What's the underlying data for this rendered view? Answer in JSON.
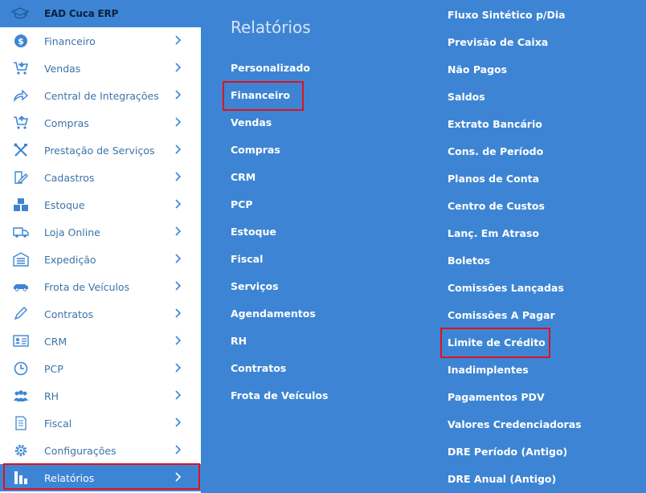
{
  "app": {
    "title": "EAD Cuca ERP"
  },
  "sidebar": {
    "items": [
      {
        "label": "Financeiro",
        "icon": "dollar-icon"
      },
      {
        "label": "Vendas",
        "icon": "cart-icon"
      },
      {
        "label": "Central de Integrações",
        "icon": "share-icon"
      },
      {
        "label": "Compras",
        "icon": "cart-icon"
      },
      {
        "label": "Prestação de Serviços",
        "icon": "tools-icon"
      },
      {
        "label": "Cadastros",
        "icon": "edit-icon"
      },
      {
        "label": "Estoque",
        "icon": "boxes-icon"
      },
      {
        "label": "Loja Online",
        "icon": "truck-icon"
      },
      {
        "label": "Expedição",
        "icon": "warehouse-icon"
      },
      {
        "label": "Frota de Veículos",
        "icon": "car-icon"
      },
      {
        "label": "Contratos",
        "icon": "pen-icon"
      },
      {
        "label": "CRM",
        "icon": "id-card-icon"
      },
      {
        "label": "PCP",
        "icon": "clock-icon"
      },
      {
        "label": "RH",
        "icon": "users-icon"
      },
      {
        "label": "Fiscal",
        "icon": "document-icon"
      },
      {
        "label": "Configurações",
        "icon": "gear-icon"
      },
      {
        "label": "Relatórios",
        "icon": "bar-chart-icon",
        "active": true
      }
    ]
  },
  "main": {
    "title": "Relatórios",
    "column1": [
      "Personalizado",
      "Financeiro",
      "Vendas",
      "Compras",
      "CRM",
      "PCP",
      "Estoque",
      "Fiscal",
      "Serviços",
      "Agendamentos",
      "RH",
      "Contratos",
      "Frota de Veículos"
    ],
    "column2": [
      "Fluxo Sintético p/Dia",
      "Previsão de Caixa",
      "Não Pagos",
      "Saldos",
      "Extrato Bancário",
      "Cons. de Período",
      "Planos de Conta",
      "Centro de Custos",
      "Lanç. Em Atraso",
      "Boletos",
      "Comissões Lançadas",
      "Comissões A Pagar",
      "Limite de Crédito",
      "Inadimplentes",
      "Pagamentos PDV",
      "Valores Credenciadoras",
      "DRE Período (Antigo)",
      "DRE Anual (Antigo)"
    ]
  },
  "colors": {
    "accent": "#3d85d4",
    "highlight": "#e3101b",
    "sidebar_text": "#3c73a8"
  }
}
